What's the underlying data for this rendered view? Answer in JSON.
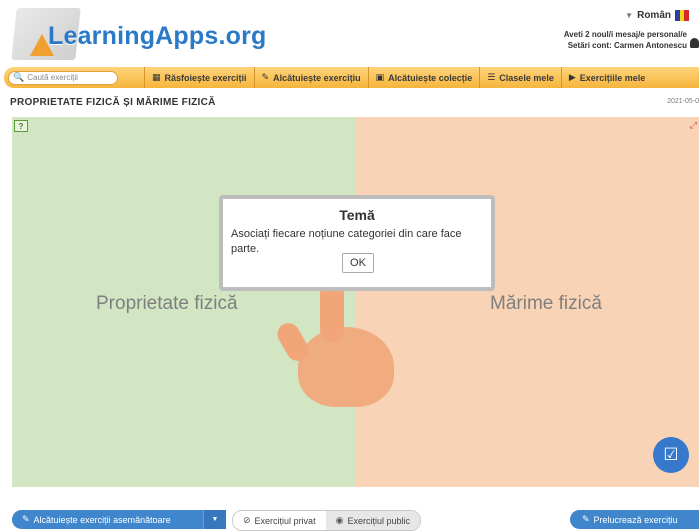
{
  "header": {
    "logo_text": "LearningApps.org",
    "language": "Român",
    "flag_colors": [
      "#2a3fa0",
      "#f7d617",
      "#d52a2a"
    ],
    "messages_line": "Aveti 2 noul/i mesaj/e personal/e",
    "account_line": "Setări cont: Carmen Antonescu"
  },
  "nav": {
    "search_placeholder": "Caută exerciții",
    "items": [
      {
        "label": "Răsfoiește exerciții",
        "icon": "grid-icon"
      },
      {
        "label": "Alcătuiește exercițiu",
        "icon": "pencil-icon"
      },
      {
        "label": "Alcătuiește colecție",
        "icon": "collection-icon"
      },
      {
        "label": "Clasele mele",
        "icon": "list-icon"
      },
      {
        "label": "Exercițiile mele",
        "icon": "folder-icon"
      }
    ]
  },
  "page": {
    "title": "PROPRIETATE FIZICĂ ȘI MĂRIME FIZICĂ",
    "date": "2021-05-0"
  },
  "exercise": {
    "category_left": "Proprietate fizică",
    "category_right": "Mărime fizică",
    "left_color": "#d3e6c3",
    "right_color": "#f8d3b5"
  },
  "dialog": {
    "title": "Temă",
    "message": "Asociați fiecare noțiune categoriei din care face parte.",
    "ok_label": "OK"
  },
  "bottom": {
    "similar_label": "Alcătuiește exerciții asemănătoare",
    "private_label": "Exercițiul privat",
    "public_label": "Exercițiul public",
    "edit_label": "Prelucrează exercițiu"
  },
  "colors": {
    "accent": "#3f86cc",
    "nav_bar": "#f5b53c"
  }
}
